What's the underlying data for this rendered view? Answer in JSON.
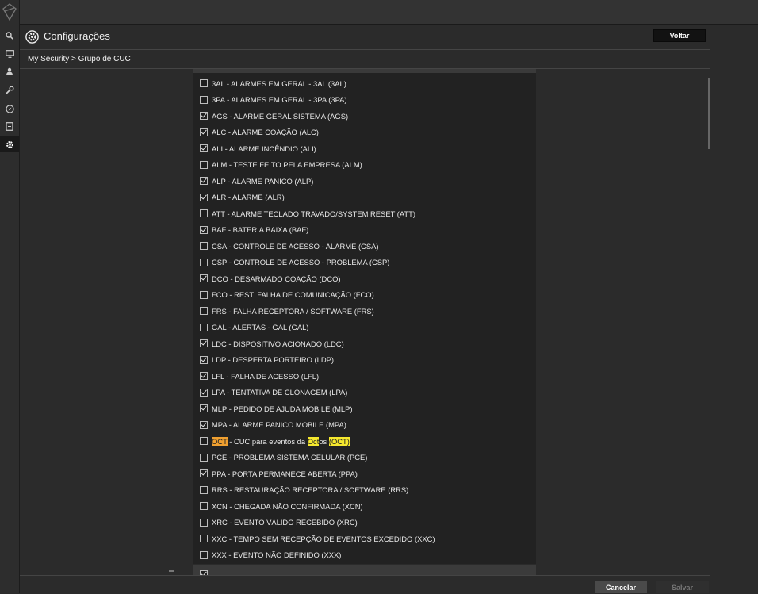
{
  "header": {
    "title": "Configurações",
    "back_label": "Voltar"
  },
  "breadcrumb": "My Security > Grupo de CUC",
  "items": [
    {
      "code": "3AL",
      "text": "3AL - ALARMES EM GERAL - 3AL (3AL)",
      "checked": false
    },
    {
      "code": "3PA",
      "text": "3PA - ALARMES EM GERAL - 3PA (3PA)",
      "checked": false
    },
    {
      "code": "AGS",
      "text": "AGS - ALARME GERAL SISTEMA (AGS)",
      "checked": true
    },
    {
      "code": "ALC",
      "text": "ALC - ALARME COAÇÃO (ALC)",
      "checked": true
    },
    {
      "code": "ALI",
      "text": "ALI - ALARME INCÊNDIO (ALI)",
      "checked": true
    },
    {
      "code": "ALM",
      "text": "ALM - TESTE FEITO PELA EMPRESA (ALM)",
      "checked": false
    },
    {
      "code": "ALP",
      "text": "ALP - ALARME PANICO (ALP)",
      "checked": true
    },
    {
      "code": "ALR",
      "text": "ALR - ALARME (ALR)",
      "checked": true
    },
    {
      "code": "ATT",
      "text": "ATT - ALARME TECLADO TRAVADO/SYSTEM RESET (ATT)",
      "checked": false
    },
    {
      "code": "BAF",
      "text": "BAF - BATERIA BAIXA (BAF)",
      "checked": true
    },
    {
      "code": "CSA",
      "text": "CSA - CONTROLE DE ACESSO - ALARME (CSA)",
      "checked": false
    },
    {
      "code": "CSP",
      "text": "CSP - CONTROLE DE ACESSO - PROBLEMA (CSP)",
      "checked": false
    },
    {
      "code": "DCO",
      "text": "DCO - DESARMADO COAÇÃO (DCO)",
      "checked": true
    },
    {
      "code": "FCO",
      "text": "FCO - REST. FALHA DE COMUNICAÇÃO (FCO)",
      "checked": false
    },
    {
      "code": "FRS",
      "text": "FRS - FALHA RECEPTORA / SOFTWARE (FRS)",
      "checked": false
    },
    {
      "code": "GAL",
      "text": "GAL - ALERTAS - GAL (GAL)",
      "checked": false
    },
    {
      "code": "LDC",
      "text": "LDC - DISPOSITIVO ACIONADO (LDC)",
      "checked": true
    },
    {
      "code": "LDP",
      "text": "LDP - DESPERTA PORTEIRO (LDP)",
      "checked": true
    },
    {
      "code": "LFL",
      "text": "LFL - FALHA DE ACESSO (LFL)",
      "checked": true
    },
    {
      "code": "LPA",
      "text": "LPA - TENTATIVA DE CLONAGEM (LPA)",
      "checked": true
    },
    {
      "code": "MLP",
      "text": "MLP - PEDIDO DE AJUDA MOBILE (MLP)",
      "checked": true
    },
    {
      "code": "MPA",
      "text": "MPA - ALARME PANICO MOBILE (MPA)",
      "checked": true
    },
    {
      "code": "OCT",
      "text": "OCT - CUC para eventos da Octos (OCT)",
      "checked": false,
      "segments": [
        {
          "t": "OCT",
          "hl": "orange"
        },
        {
          "t": " - CUC para eventos da ",
          "hl": ""
        },
        {
          "t": "Oct",
          "hl": "yellow"
        },
        {
          "t": "os ",
          "hl": ""
        },
        {
          "t": "(OCT)",
          "hl": "yellow"
        }
      ]
    },
    {
      "code": "PCE",
      "text": "PCE - PROBLEMA SISTEMA CELULAR (PCE)",
      "checked": false
    },
    {
      "code": "PPA",
      "text": "PPA - PORTA PERMANECE ABERTA (PPA)",
      "checked": true
    },
    {
      "code": "RRS",
      "text": "RRS - RESTAURAÇÃO RECEPTORA / SOFTWARE (RRS)",
      "checked": false
    },
    {
      "code": "XCN",
      "text": "XCN - CHEGADA NÃO CONFIRMADA (XCN)",
      "checked": false
    },
    {
      "code": "XRC",
      "text": "XRC - EVENTO VÁLIDO RECEBIDO (XRC)",
      "checked": false
    },
    {
      "code": "XXC",
      "text": "XXC - TEMPO SEM RECEPÇÃO DE EVENTOS EXCEDIDO (XXC)",
      "checked": false
    },
    {
      "code": "XXX",
      "text": "XXX - EVENTO NÃO DEFINIDO (XXX)",
      "checked": false
    }
  ],
  "next_row": {
    "checked": true
  },
  "footer": {
    "cancel_label": "Cancelar",
    "save_label": "Salvar"
  },
  "icons": {
    "rail": [
      "logo-icon",
      "search-icon",
      "monitor-icon",
      "user-icon",
      "wrench-icon",
      "compass-icon",
      "document-icon",
      "gear-icon"
    ]
  },
  "colors": {
    "highlight_orange": "#f0a030",
    "highlight_yellow": "#f5e82e"
  }
}
